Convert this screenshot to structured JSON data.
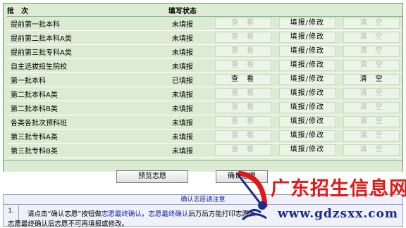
{
  "table": {
    "headers": {
      "batch": "批　次",
      "status": "填写状态"
    },
    "rows": [
      {
        "batch": "提前第一批本科",
        "status": "未填报",
        "view": "查　看",
        "view_enabled": false,
        "edit": "填报/修改",
        "clear": "清　空",
        "clear_enabled": false
      },
      {
        "batch": "提前第二批本科A类",
        "status": "未填报",
        "view": "查　看",
        "view_enabled": false,
        "edit": "填报/修改",
        "clear": "清　空",
        "clear_enabled": false
      },
      {
        "batch": "提前第三批专科A类",
        "status": "未填报",
        "view": "查　看",
        "view_enabled": false,
        "edit": "填报/修改",
        "clear": "清　空",
        "clear_enabled": false
      },
      {
        "batch": "自主选拔招生院校",
        "status": "未填报",
        "view": "查　看",
        "view_enabled": false,
        "edit": "填报/修改",
        "clear": "清　空",
        "clear_enabled": false
      },
      {
        "batch": "第一批本科",
        "status": "已填报",
        "view": "查　看",
        "view_enabled": true,
        "edit": "填报/修改",
        "clear": "清　空",
        "clear_enabled": true
      },
      {
        "batch": "第二批本科A类",
        "status": "未填报",
        "view": "查　看",
        "view_enabled": false,
        "edit": "填报/修改",
        "clear": "清　空",
        "clear_enabled": false
      },
      {
        "batch": "第二批本科B类",
        "status": "未填报",
        "view": "查　看",
        "view_enabled": false,
        "edit": "填报/修改",
        "clear": "清　空",
        "clear_enabled": false
      },
      {
        "batch": "各类各批次预科班",
        "status": "未填报",
        "view": "查　看",
        "view_enabled": false,
        "edit": "填报/修改",
        "clear": "清　空",
        "clear_enabled": false
      },
      {
        "batch": "第三批专科A类",
        "status": "未填报",
        "view": "查　看",
        "view_enabled": false,
        "edit": "填报/修改",
        "clear": "清　空",
        "clear_enabled": false
      },
      {
        "batch": "第三批专科B类",
        "status": "未填报",
        "view": "查　看",
        "view_enabled": false,
        "edit": "填报/修改",
        "clear": "清　空",
        "clear_enabled": false
      }
    ]
  },
  "actions": {
    "preview": "预览志愿",
    "confirm": "确认志愿"
  },
  "notice": {
    "title": "确认志愿请注意",
    "number": "1.",
    "line1_a": "请点击“确认志愿”按钮做",
    "line1_b": "志愿最终确认",
    "line1_c": "。",
    "line1_d": "志愿最终确认",
    "line1_e": "后万",
    "line1_f": "后方能打印志愿表",
    "line2": "志愿最终确认后志愿不可再填报或修改。"
  },
  "watermark": {
    "site_name": "广东招生信息网",
    "url": "www.gdzsxx.com"
  },
  "colors": {
    "panel_bg": "#dcecd4",
    "panel_border": "#5a9a5a",
    "notice_blue": "#1a2aa0",
    "watermark_red": "#e01818"
  },
  "icons": {
    "watermark_logo": "satellite-dish-logo-icon"
  }
}
